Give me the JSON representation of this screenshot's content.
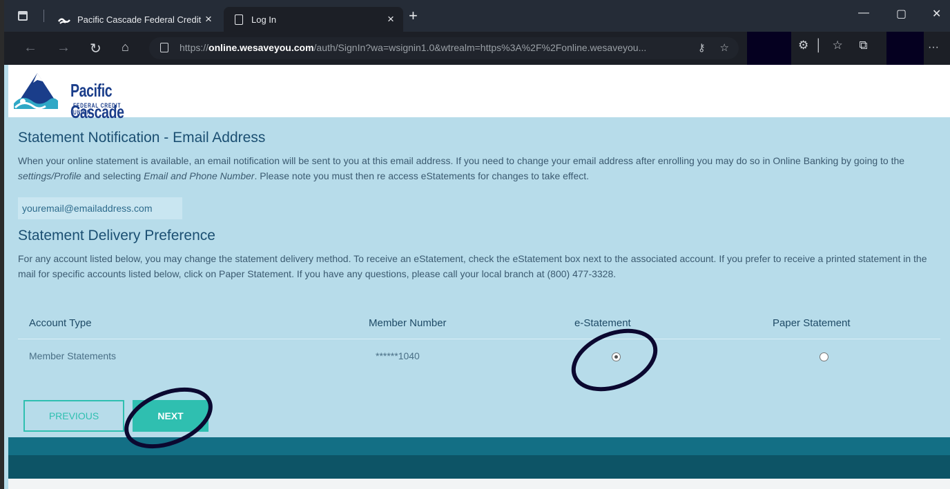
{
  "browser": {
    "tabs": [
      {
        "title": "Pacific Cascade Federal Credit Ur",
        "close": "×",
        "active": false
      },
      {
        "title": "Log In",
        "close": "×",
        "active": true
      }
    ],
    "new_tab": "+",
    "window_controls": {
      "minimize": "—",
      "maximize": "▢",
      "close": "✕"
    },
    "url_scheme": "https://",
    "url_host": "online.wesaveyou.com",
    "url_path": "/auth/SignIn?wa=wsignin1.0&wtrealm=https%3A%2F%2Fonline.wesaveyou...",
    "menu": "···"
  },
  "logo": {
    "name": "Pacific Cascade",
    "subtitle": "FEDERAL CREDIT UNION"
  },
  "email_section": {
    "title": "Statement Notification - Email Address",
    "text_1": "When your online statement is available, an email notification will be sent to you at this email address. If you need to change your email address after enrolling you may do so in Online Banking by going to the ",
    "text_settings": "settings/Profile",
    "text_2": " and selecting ",
    "text_email_phone": "Email and Phone Number",
    "text_3": ". Please note you must then re access eStatements for changes to take effect.",
    "email": "youremail@emailaddress.com"
  },
  "delivery_section": {
    "title": "Statement Delivery Preference",
    "text": "For any account listed below, you may change the statement delivery method. To receive an eStatement, check the eStatement box next to the associated account. If you prefer to receive a printed statement in the mail for specific accounts listed below, click on Paper Statement. If you have any questions, please call your local branch at (800) 477-3328."
  },
  "table": {
    "headers": [
      "Account Type",
      "Member Number",
      "e-Statement",
      "Paper Statement"
    ],
    "rows": [
      {
        "account_type": "Member Statements",
        "member_number": "******1040",
        "selected": "e-Statement"
      }
    ]
  },
  "buttons": {
    "previous": "PREVIOUS",
    "next": "NEXT"
  },
  "colors": {
    "accent": "#2fbfb0",
    "page_bg": "#b7dcea",
    "annotation": "#0b0830"
  }
}
